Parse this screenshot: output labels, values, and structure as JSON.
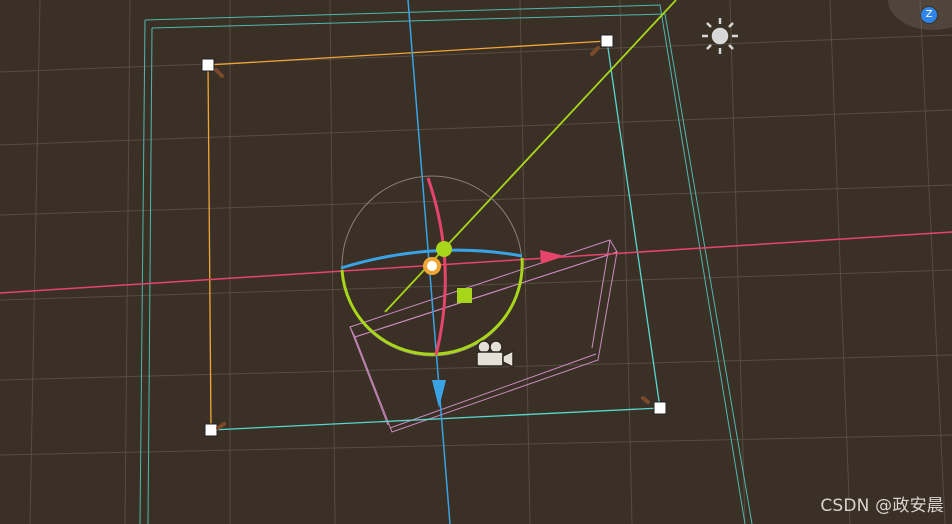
{
  "scene": {
    "background": "#3b3026",
    "colors": {
      "grid": "#5a4f45",
      "x_axis": "#e5446b",
      "y_axis": "#3aa3e6",
      "z_axis": "#a8d61a",
      "bounds_cyan": "#57d6cf",
      "bounds_orange": "#f0a636",
      "frustum": "#c98bbf"
    },
    "icons": {
      "light": "sun-icon",
      "camera": "camera-icon",
      "handles": "corner-handle"
    }
  },
  "orientation_gizmo": {
    "z_label": "Z"
  },
  "watermark": "CSDN @政安晨"
}
